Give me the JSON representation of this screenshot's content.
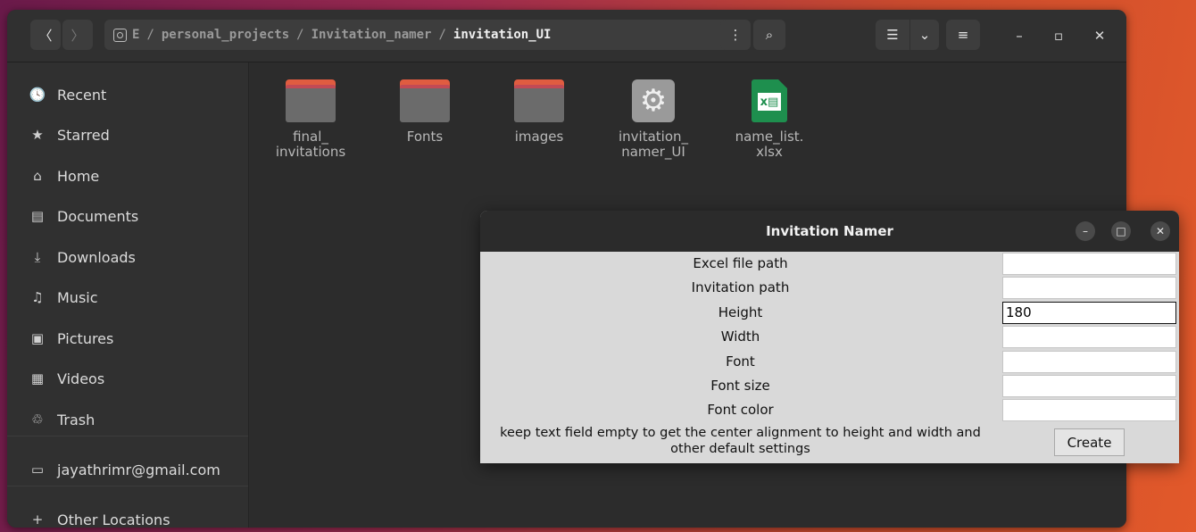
{
  "file_manager": {
    "path": {
      "drive": "E",
      "segments": [
        "personal_projects",
        "Invitation_namer"
      ],
      "current": "invitation_UI"
    },
    "sidebar": [
      {
        "icon": "clock-icon",
        "glyph": "🕓",
        "label": "Recent"
      },
      {
        "icon": "star-icon",
        "glyph": "★",
        "label": "Starred"
      },
      {
        "icon": "home-icon",
        "glyph": "⌂",
        "label": "Home"
      },
      {
        "icon": "document-icon",
        "glyph": "▤",
        "label": "Documents"
      },
      {
        "icon": "download-icon",
        "glyph": "⤓",
        "label": "Downloads"
      },
      {
        "icon": "music-icon",
        "glyph": "♫",
        "label": "Music"
      },
      {
        "icon": "picture-icon",
        "glyph": "▣",
        "label": "Pictures"
      },
      {
        "icon": "video-icon",
        "glyph": "▦",
        "label": "Videos"
      },
      {
        "icon": "trash-icon",
        "glyph": "♲",
        "label": "Trash"
      },
      {
        "icon": "drive-icon",
        "glyph": "▭",
        "label": "jayathrimr@gmail.com"
      },
      {
        "icon": "plus-icon",
        "glyph": "+",
        "label": "Other Locations"
      }
    ],
    "files": [
      {
        "type": "folder",
        "line1": "final_",
        "line2": "invitations"
      },
      {
        "type": "folder",
        "line1": "Fonts",
        "line2": ""
      },
      {
        "type": "folder",
        "line1": "images",
        "line2": ""
      },
      {
        "type": "executable",
        "line1": "invitation_",
        "line2": "namer_UI"
      },
      {
        "type": "spreadsheet",
        "line1": "name_list.",
        "line2": "xlsx"
      }
    ]
  },
  "dialog": {
    "title": "Invitation Namer",
    "fields": [
      {
        "label": "Excel file path",
        "value": ""
      },
      {
        "label": "Invitation path",
        "value": ""
      },
      {
        "label": "Height",
        "value": "180"
      },
      {
        "label": "Width",
        "value": ""
      },
      {
        "label": "Font",
        "value": ""
      },
      {
        "label": "Font size",
        "value": ""
      },
      {
        "label": "Font color",
        "value": ""
      }
    ],
    "note_line1": "keep text field empty to get the center alignment to height and width and",
    "note_line2": "other default settings",
    "create_label": "Create"
  }
}
